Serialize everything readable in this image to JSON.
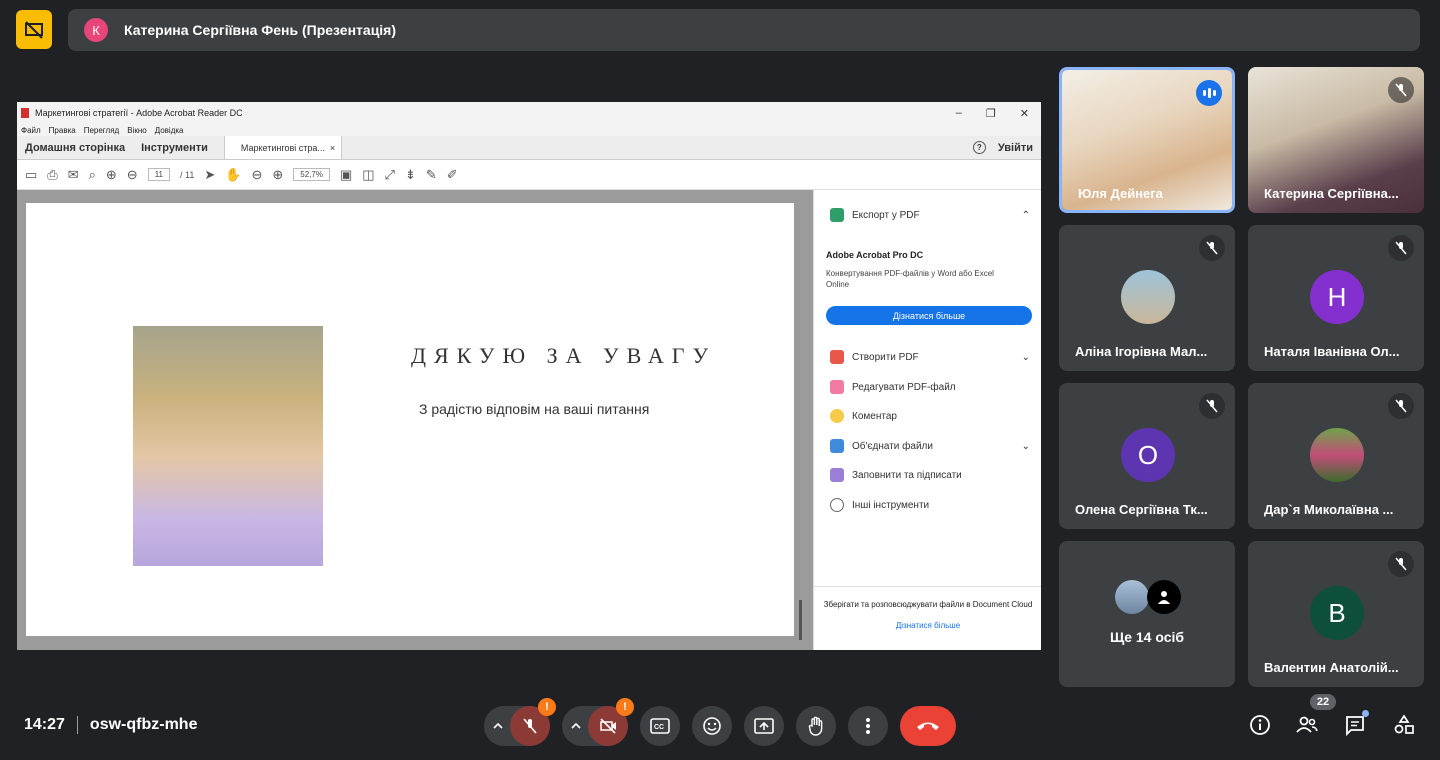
{
  "header": {
    "avatar_letter": "К",
    "title": "Катерина Сергіївна Фень (Презентація)"
  },
  "acrobat": {
    "window_title": "Маркетингові стратегії - Adobe Acrobat Reader DC",
    "menu": [
      "Файл",
      "Правка",
      "Перегляд",
      "Вікно",
      "Довідка"
    ],
    "tabs": {
      "home": "Домашня сторінка",
      "tools": "Інструменти",
      "doc": "Маркетингові стра...",
      "close": "×"
    },
    "signin": "Увійти",
    "help": "?",
    "page_current": "11",
    "page_total": "/ 11",
    "zoom": "52,7%",
    "slide_title": "ДЯКУЮ ЗА УВАГУ",
    "slide_subtitle": "З радістю відповім на ваші питання",
    "side": {
      "export": "Експорт у PDF",
      "promo_title": "Adobe Acrobat Pro DC",
      "promo_text": "Конвертування PDF-файлів у Word або Excel Online",
      "promo_button": "Дізнатися більше",
      "create": "Створити PDF",
      "edit": "Редагувати PDF-файл",
      "comment": "Коментар",
      "combine": "Об'єднати файли",
      "fill": "Заповнити та підписати",
      "other": "Інші інструменти",
      "footer": "Зберігати та розповсюджувати файли в Document Cloud",
      "footer_link": "Дізнатися більше"
    }
  },
  "participants": [
    {
      "name": "Юля Дейнега"
    },
    {
      "name": "Катерина Сергіївна..."
    },
    {
      "name": "Аліна Ігорівна Мал..."
    },
    {
      "name": "Наталя Іванівна Ол...",
      "letter": "Н",
      "color": "#8430ce"
    },
    {
      "name": "Олена Сергіївна Тк...",
      "letter": "О",
      "color": "#5e35b1"
    },
    {
      "name": "Дар`я Миколаївна ..."
    },
    {
      "name": "Ще 14 осіб"
    },
    {
      "name": "Валентин Анатолій...",
      "letter": "В",
      "color": "#0d4f3c"
    }
  ],
  "bottom": {
    "time": "14:27",
    "meeting_code": "osw-qfbz-mhe",
    "warn": "!",
    "people_count": "22"
  }
}
